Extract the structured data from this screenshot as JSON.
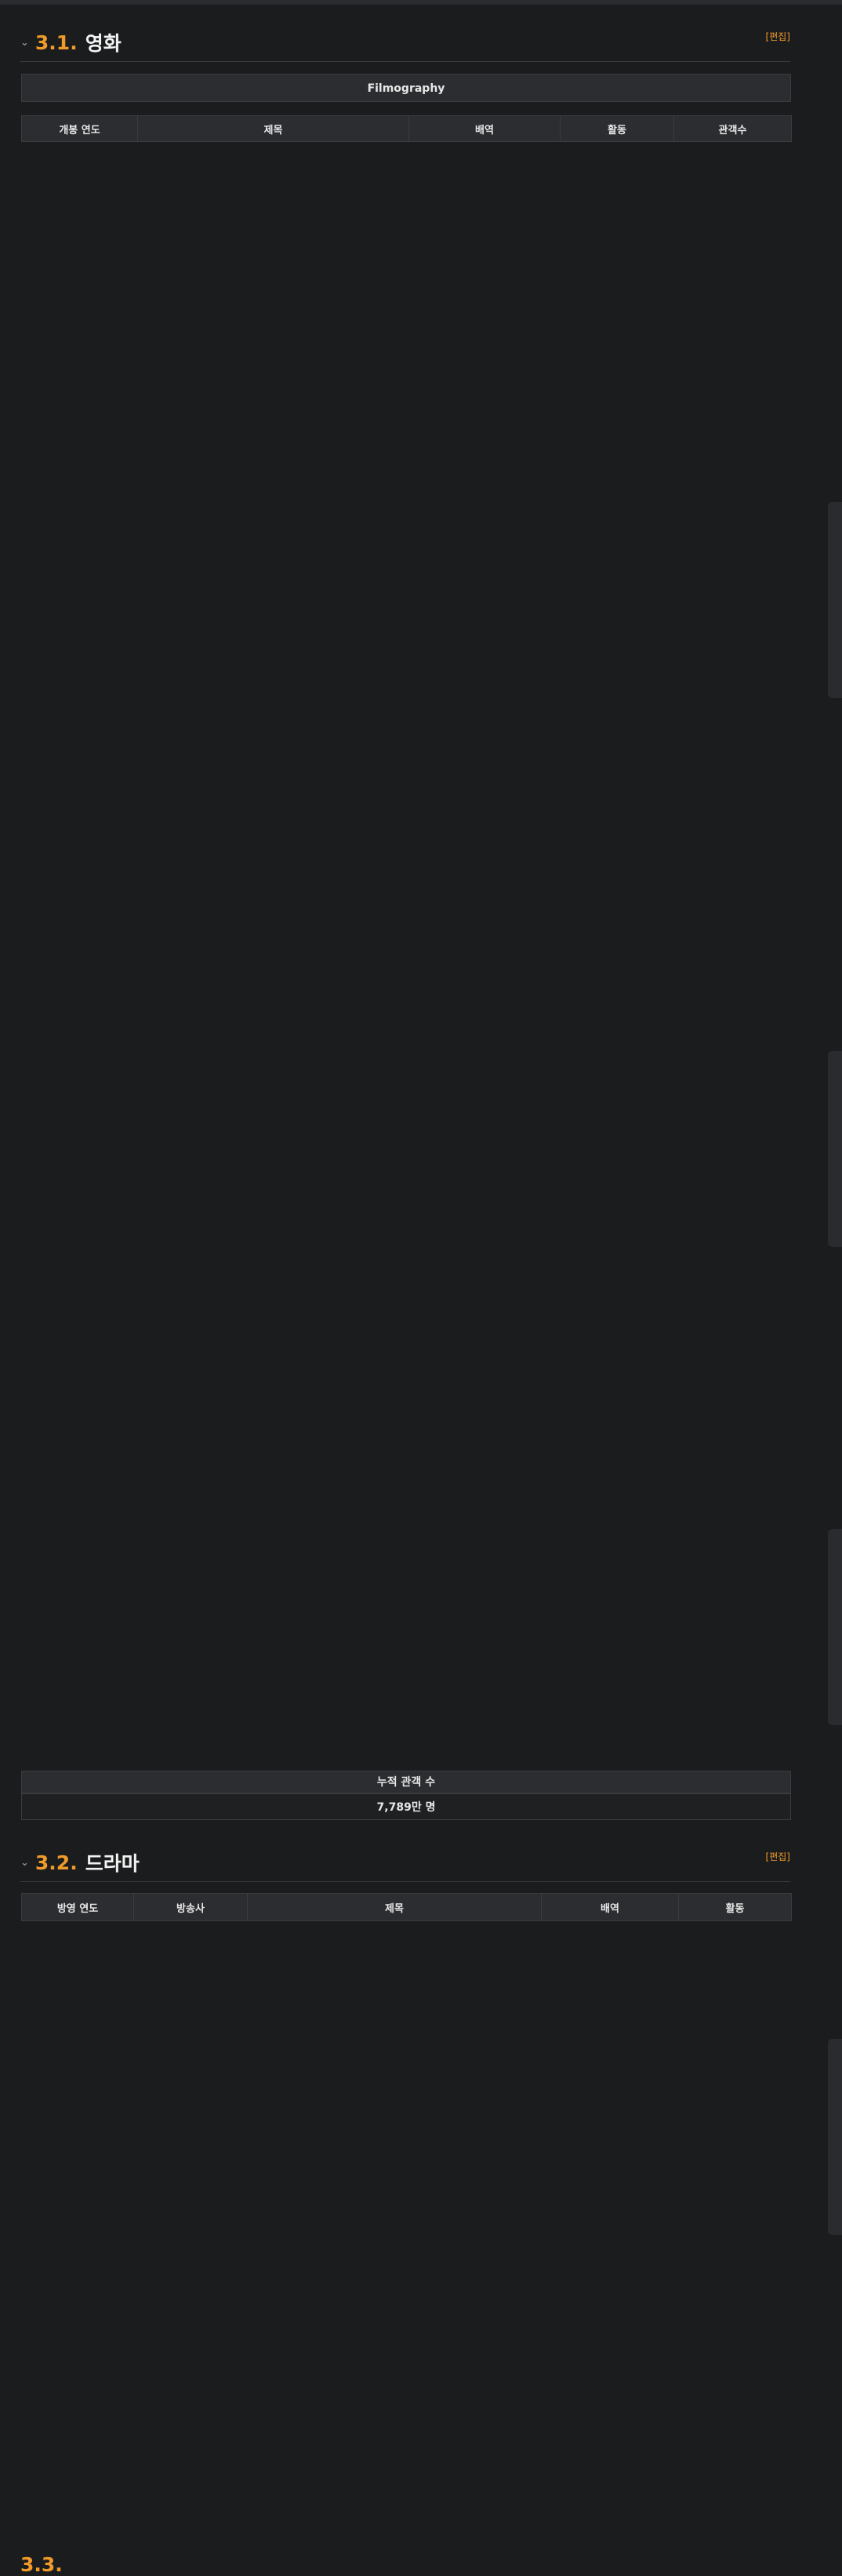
{
  "sections": {
    "film": {
      "num": "3.1.",
      "title": "영화",
      "edit": "[편집]"
    },
    "drama": {
      "num": "3.2.",
      "title": "드라마",
      "edit": "[편집]"
    },
    "next": {
      "num": "3.3."
    }
  },
  "film_table": {
    "caption": "Filmography",
    "headers": [
      "개봉 연도",
      "제목",
      "배역",
      "활동",
      "관객수"
    ],
    "total_label": "누적 관객 수",
    "total_value": "7,789만 명"
  },
  "drama_table": {
    "headers": [
      "방영 연도",
      "방송사",
      "제목",
      "배역",
      "활동"
    ]
  }
}
